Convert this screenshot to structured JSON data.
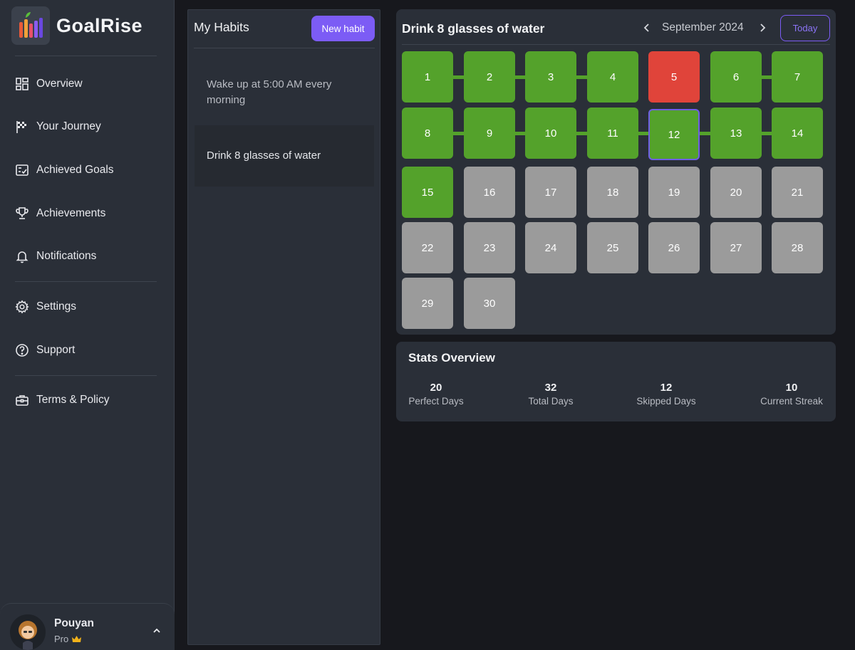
{
  "app": {
    "name": "GoalRise"
  },
  "sidebar": {
    "items": [
      {
        "label": "Overview",
        "icon": "dashboard-icon"
      },
      {
        "label": "Your Journey",
        "icon": "checkered-flag-icon"
      },
      {
        "label": "Achieved Goals",
        "icon": "checklist-icon"
      },
      {
        "label": "Achievements",
        "icon": "trophy-icon"
      },
      {
        "label": "Notifications",
        "icon": "bell-icon"
      },
      {
        "label": "Settings",
        "icon": "gear-icon"
      },
      {
        "label": "Support",
        "icon": "help-circle-icon"
      },
      {
        "label": "Terms & Policy",
        "icon": "briefcase-icon"
      }
    ]
  },
  "profile": {
    "name": "Pouyan",
    "tier": "Pro"
  },
  "habits": {
    "title": "My Habits",
    "new_button": "New habit",
    "list": [
      {
        "label": "Wake up at 5:00 AM every morning",
        "selected": false
      },
      {
        "label": "Drink 8 glasses of water",
        "selected": true
      }
    ]
  },
  "calendar": {
    "title": "Drink 8 glasses of water",
    "month": "September 2024",
    "today_button": "Today",
    "today_day": 12,
    "days": [
      {
        "day": "1",
        "status": "done"
      },
      {
        "day": "2",
        "status": "done"
      },
      {
        "day": "3",
        "status": "done"
      },
      {
        "day": "4",
        "status": "done"
      },
      {
        "day": "5",
        "status": "missed"
      },
      {
        "day": "6",
        "status": "done"
      },
      {
        "day": "7",
        "status": "done"
      },
      {
        "day": "8",
        "status": "done"
      },
      {
        "day": "9",
        "status": "done"
      },
      {
        "day": "10",
        "status": "done"
      },
      {
        "day": "11",
        "status": "done"
      },
      {
        "day": "12",
        "status": "done"
      },
      {
        "day": "13",
        "status": "done"
      },
      {
        "day": "14",
        "status": "done"
      },
      {
        "day": "15",
        "status": "done"
      },
      {
        "day": "16",
        "status": "future"
      },
      {
        "day": "17",
        "status": "future"
      },
      {
        "day": "18",
        "status": "future"
      },
      {
        "day": "19",
        "status": "future"
      },
      {
        "day": "20",
        "status": "future"
      },
      {
        "day": "21",
        "status": "future"
      },
      {
        "day": "22",
        "status": "future"
      },
      {
        "day": "23",
        "status": "future"
      },
      {
        "day": "24",
        "status": "future"
      },
      {
        "day": "25",
        "status": "future"
      },
      {
        "day": "26",
        "status": "future"
      },
      {
        "day": "27",
        "status": "future"
      },
      {
        "day": "28",
        "status": "future"
      },
      {
        "day": "29",
        "status": "future"
      },
      {
        "day": "30",
        "status": "future"
      }
    ],
    "colors": {
      "done": "#54a22b",
      "missed": "#e0443a",
      "future": "#9b9b9b",
      "accent": "#7c5cf5"
    }
  },
  "stats": {
    "title": "Stats Overview",
    "items": [
      {
        "value": "20",
        "label": "Perfect Days"
      },
      {
        "value": "32",
        "label": "Total Days"
      },
      {
        "value": "12",
        "label": "Skipped Days"
      },
      {
        "value": "10",
        "label": "Current Streak"
      }
    ]
  }
}
